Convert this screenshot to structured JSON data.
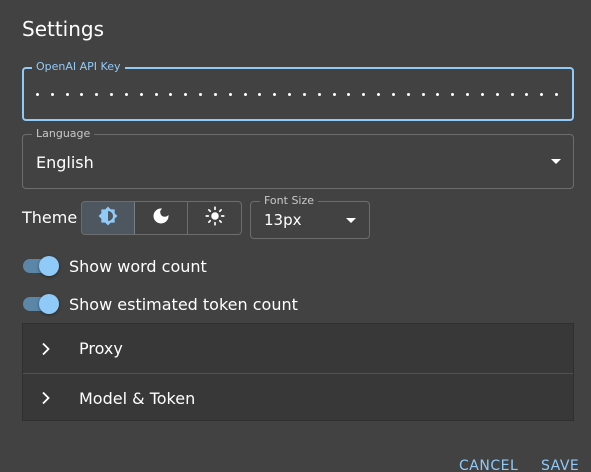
{
  "dialog": {
    "title": "Settings"
  },
  "api_key": {
    "label": "OpenAI API Key",
    "masked_char_count": 36
  },
  "language": {
    "label": "Language",
    "value": "English"
  },
  "theme": {
    "label": "Theme",
    "options": [
      {
        "icon": "auto-brightness-icon",
        "selected": true
      },
      {
        "icon": "moon-icon",
        "selected": false
      },
      {
        "icon": "sun-icon",
        "selected": false
      }
    ]
  },
  "font_size": {
    "label": "Font Size",
    "value": "13px"
  },
  "toggles": {
    "word_count": {
      "label": "Show word count",
      "on": true
    },
    "token_count": {
      "label": "Show estimated token count",
      "on": true
    }
  },
  "accordion": {
    "items": [
      {
        "label": "Proxy",
        "icon": "chevron-right-icon"
      },
      {
        "label": "Model & Token",
        "icon": "chevron-right-icon"
      }
    ]
  },
  "actions": {
    "cancel": "CANCEL",
    "save": "SAVE"
  },
  "colors": {
    "accent": "#90caf9",
    "background": "#424242",
    "panel": "#383838"
  }
}
